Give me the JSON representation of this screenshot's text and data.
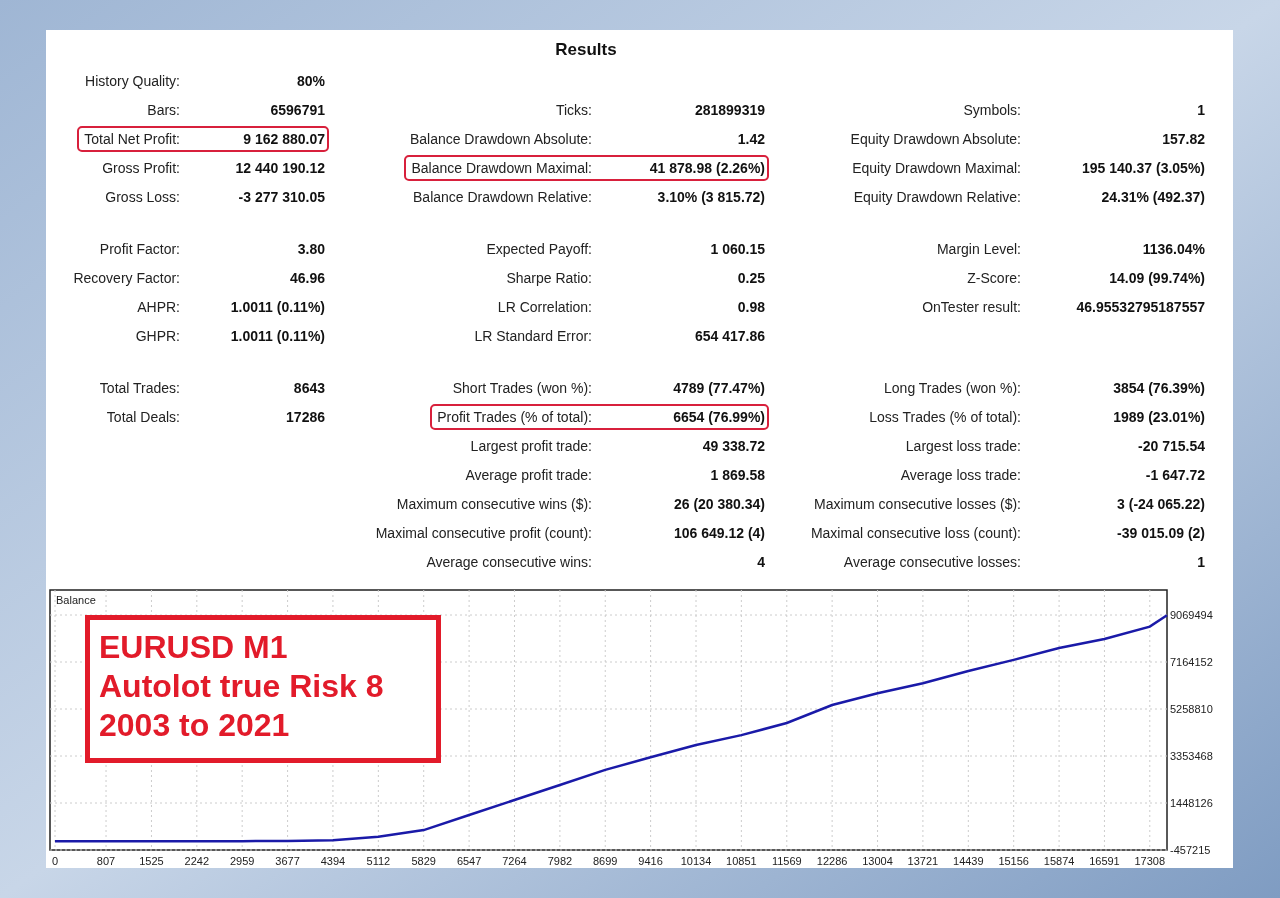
{
  "title": "Results",
  "sections": [
    {
      "rows": [
        [
          {
            "label": "History Quality:",
            "value": "80%",
            "highlighted": false
          },
          null,
          null
        ],
        [
          {
            "label": "Bars:",
            "value": "6596791",
            "highlighted": false
          },
          {
            "label": "Ticks:",
            "value": "281899319",
            "highlighted": false
          },
          {
            "label": "Symbols:",
            "value": "1",
            "highlighted": false
          }
        ],
        [
          {
            "label": "Total Net Profit:",
            "value": "9 162 880.07",
            "highlighted": true
          },
          {
            "label": "Balance Drawdown Absolute:",
            "value": "1.42",
            "highlighted": false
          },
          {
            "label": "Equity Drawdown Absolute:",
            "value": "157.82",
            "highlighted": false
          }
        ],
        [
          {
            "label": "Gross Profit:",
            "value": "12 440 190.12",
            "highlighted": false
          },
          {
            "label": "Balance Drawdown Maximal:",
            "value": "41 878.98 (2.26%)",
            "highlighted": true
          },
          {
            "label": "Equity Drawdown Maximal:",
            "value": "195 140.37 (3.05%)",
            "highlighted": false
          }
        ],
        [
          {
            "label": "Gross Loss:",
            "value": "-3 277 310.05",
            "highlighted": false
          },
          {
            "label": "Balance Drawdown Relative:",
            "value": "3.10% (3 815.72)",
            "highlighted": false
          },
          {
            "label": "Equity Drawdown Relative:",
            "value": "24.31% (492.37)",
            "highlighted": false
          }
        ]
      ]
    },
    {
      "rows": [
        [
          {
            "label": "Profit Factor:",
            "value": "3.80",
            "highlighted": false
          },
          {
            "label": "Expected Payoff:",
            "value": "1 060.15",
            "highlighted": false
          },
          {
            "label": "Margin Level:",
            "value": "1136.04%",
            "highlighted": false
          }
        ],
        [
          {
            "label": "Recovery Factor:",
            "value": "46.96",
            "highlighted": false
          },
          {
            "label": "Sharpe Ratio:",
            "value": "0.25",
            "highlighted": false
          },
          {
            "label": "Z-Score:",
            "value": "14.09 (99.74%)",
            "highlighted": false
          }
        ],
        [
          {
            "label": "AHPR:",
            "value": "1.0011 (0.11%)",
            "highlighted": false
          },
          {
            "label": "LR Correlation:",
            "value": "0.98",
            "highlighted": false
          },
          {
            "label": "OnTester result:",
            "value": "46.95532795187557",
            "highlighted": false
          }
        ],
        [
          {
            "label": "GHPR:",
            "value": "1.0011 (0.11%)",
            "highlighted": false
          },
          {
            "label": "LR Standard Error:",
            "value": "654 417.86",
            "highlighted": false
          },
          null
        ]
      ]
    },
    {
      "rows": [
        [
          {
            "label": "Total Trades:",
            "value": "8643",
            "highlighted": false
          },
          {
            "label": "Short Trades (won %):",
            "value": "4789 (77.47%)",
            "highlighted": false
          },
          {
            "label": "Long Trades (won %):",
            "value": "3854 (76.39%)",
            "highlighted": false
          }
        ],
        [
          {
            "label": "Total Deals:",
            "value": "17286",
            "highlighted": false
          },
          {
            "label": "Profit Trades (% of total):",
            "value": "6654 (76.99%)",
            "highlighted": true
          },
          {
            "label": "Loss Trades (% of total):",
            "value": "1989 (23.01%)",
            "highlighted": false
          }
        ],
        [
          null,
          {
            "label": "Largest profit trade:",
            "value": "49 338.72",
            "highlighted": false
          },
          {
            "label": "Largest loss trade:",
            "value": "-20 715.54",
            "highlighted": false
          }
        ],
        [
          null,
          {
            "label": "Average profit trade:",
            "value": "1 869.58",
            "highlighted": false
          },
          {
            "label": "Average loss trade:",
            "value": "-1 647.72",
            "highlighted": false
          }
        ],
        [
          null,
          {
            "label": "Maximum consecutive wins ($):",
            "value": "26 (20 380.34)",
            "highlighted": false
          },
          {
            "label": "Maximum consecutive losses ($):",
            "value": "3 (-24 065.22)",
            "highlighted": false
          }
        ],
        [
          null,
          {
            "label": "Maximal consecutive profit (count):",
            "value": "106 649.12 (4)",
            "highlighted": false
          },
          {
            "label": "Maximal consecutive loss (count):",
            "value": "-39 015.09 (2)",
            "highlighted": false
          }
        ],
        [
          null,
          {
            "label": "Average consecutive wins:",
            "value": "4",
            "highlighted": false
          },
          {
            "label": "Average consecutive losses:",
            "value": "1",
            "highlighted": false
          }
        ]
      ]
    }
  ],
  "annotation": [
    "EURUSD M1",
    "Autolot true Risk 8",
    "2003 to 2021"
  ],
  "chart": {
    "chart_data": {
      "type": "line",
      "grid": true,
      "x": [
        0,
        807,
        1525,
        2242,
        2959,
        3677,
        4394,
        5112,
        5829,
        6547,
        7264,
        7982,
        8699,
        9416,
        10134,
        10851,
        11569,
        12286,
        13004,
        13721,
        14439,
        15156,
        15874,
        16591,
        17308,
        17580
      ],
      "series": [
        {
          "name": "Balance",
          "color": "#1a1aa8",
          "values": [
            -100000,
            -100000,
            -100000,
            -100000,
            -100000,
            -90000,
            -60000,
            80000,
            350000,
            960000,
            1570000,
            2180000,
            2790000,
            3300000,
            3800000,
            4200000,
            4690000,
            5420000,
            5900000,
            6300000,
            6800000,
            7250000,
            7730000,
            8100000,
            8600000,
            9060000
          ]
        }
      ],
      "xlim": [
        0,
        17580
      ],
      "ylim": [
        -457215,
        9069494
      ],
      "xticks": [
        0,
        807,
        1525,
        2242,
        2959,
        3677,
        4394,
        5112,
        5829,
        6547,
        7264,
        7982,
        8699,
        9416,
        10134,
        10851,
        11569,
        12286,
        13004,
        13721,
        14439,
        15156,
        15874,
        16591,
        17308
      ],
      "yticks": [
        -457215,
        1448126,
        3353468,
        5258810,
        7164152,
        9069494
      ]
    }
  }
}
